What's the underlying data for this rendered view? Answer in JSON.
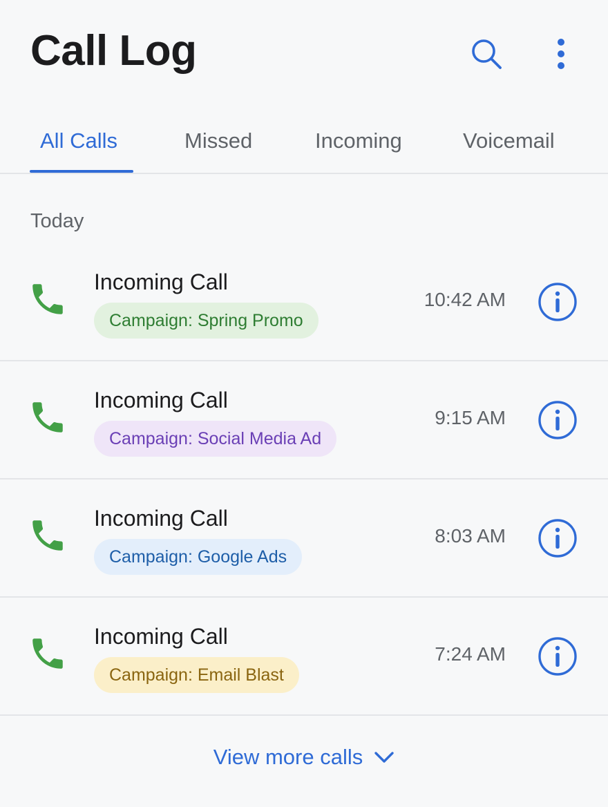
{
  "header": {
    "title": "Call Log",
    "search_icon": "search-icon",
    "more_icon": "more-vertical-icon"
  },
  "tabs": [
    {
      "label": "All Calls",
      "active": true
    },
    {
      "label": "Missed",
      "active": false
    },
    {
      "label": "Incoming",
      "active": false
    },
    {
      "label": "Voicemail",
      "active": false
    }
  ],
  "section": {
    "label": "Today"
  },
  "calls": [
    {
      "title": "Incoming Call",
      "campaign": "Campaign: Spring Promo",
      "time": "10:42 AM",
      "badge_bg": "#e2f1df",
      "badge_fg": "#2e7d32"
    },
    {
      "title": "Incoming Call",
      "campaign": "Campaign: Social Media Ad",
      "time": "9:15 AM",
      "badge_bg": "#efe5f8",
      "badge_fg": "#6a3fb5"
    },
    {
      "title": "Incoming Call",
      "campaign": "Campaign: Google Ads",
      "time": "8:03 AM",
      "badge_bg": "#e3eefb",
      "badge_fg": "#1e5ea8"
    },
    {
      "title": "Incoming Call",
      "campaign": "Campaign: Email Blast",
      "time": "7:24 AM",
      "badge_bg": "#fbefc9",
      "badge_fg": "#8a6510"
    }
  ],
  "footer": {
    "view_more": "View more calls",
    "chevron_icon": "chevron-down-icon"
  },
  "colors": {
    "accent": "#2f6bd6",
    "phone_green": "#43a047",
    "text_secondary": "#5f6368",
    "divider": "#e3e5e8"
  }
}
